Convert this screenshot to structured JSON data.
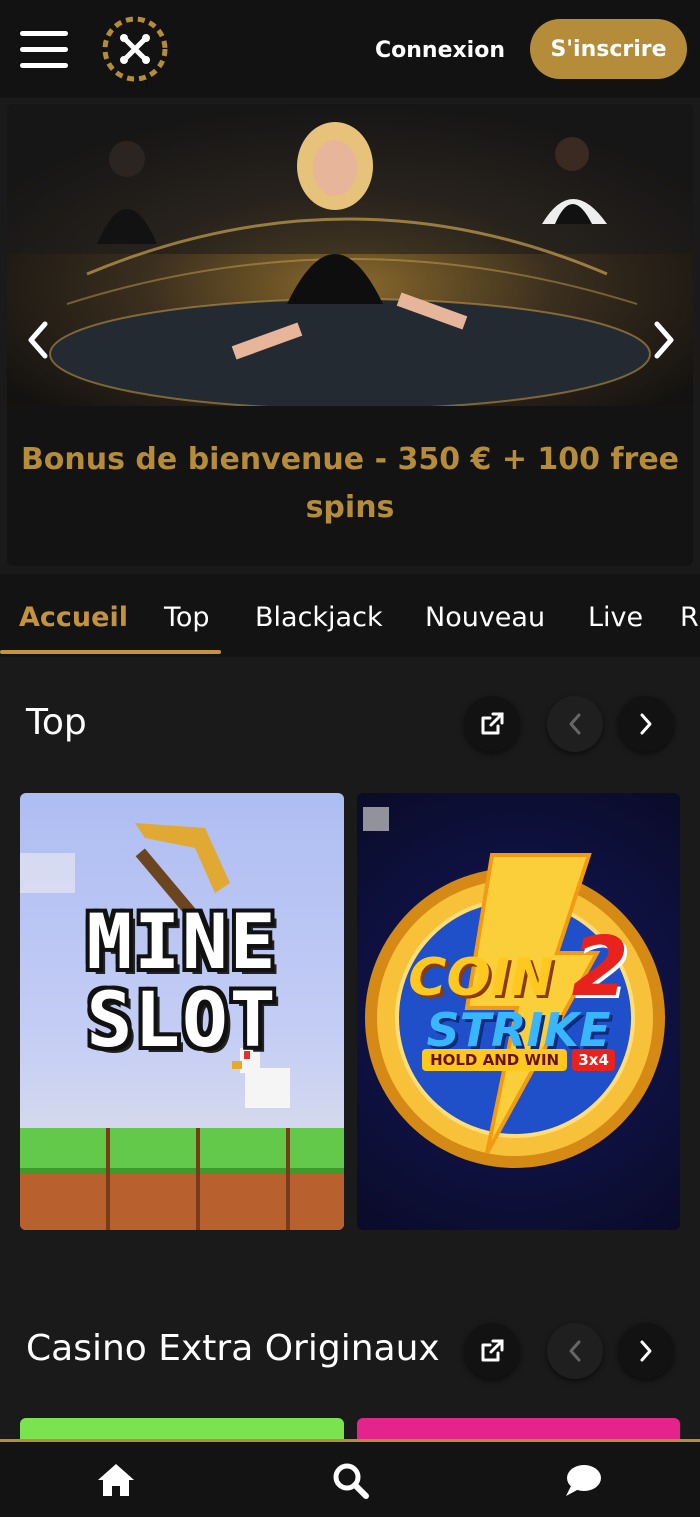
{
  "header": {
    "menu_icon": "hamburger-icon",
    "logo_icon": "brand-x-logo",
    "login_label": "Connexion",
    "signup_label": "S'inscrire"
  },
  "hero": {
    "title": "Bonus de bienvenue - 350 € + 100 free spins",
    "prev_icon": "chevron-left-icon",
    "next_icon": "chevron-right-icon"
  },
  "tabs": [
    {
      "label": "Accueil",
      "active": true
    },
    {
      "label": "Top"
    },
    {
      "label": "Blackjack"
    },
    {
      "label": "Nouveau"
    },
    {
      "label": "Live"
    },
    {
      "label": "R"
    }
  ],
  "sections": [
    {
      "title": "Top",
      "games": [
        {
          "title_line1": "MINE",
          "title_line2": "SLOT"
        },
        {
          "title_line1": "COIN",
          "title_line2": "STRIKE",
          "number": "2",
          "subtitle": "HOLD AND WIN",
          "badge": "3x4"
        }
      ]
    },
    {
      "title": "Casino Extra Originaux"
    }
  ],
  "bottom_nav": [
    {
      "icon": "home-icon"
    },
    {
      "icon": "search-icon"
    },
    {
      "icon": "chat-icon"
    }
  ],
  "colors": {
    "accent_gold": "#b58c3a",
    "background": "#1a1a1a",
    "header_bg": "#121212",
    "card_green": "#7be34f",
    "card_pink": "#e4238d"
  }
}
